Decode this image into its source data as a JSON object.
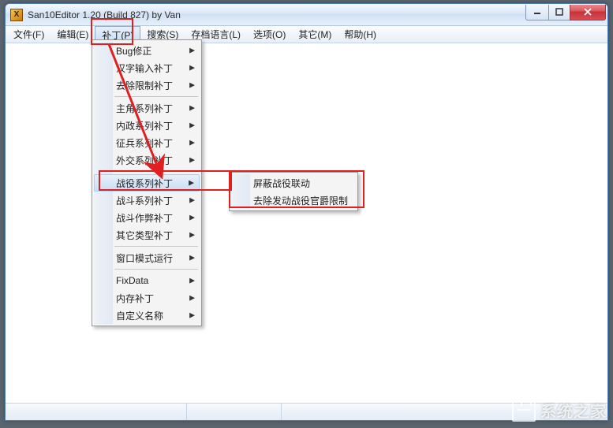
{
  "window": {
    "title": "San10Editor 1.20 (Build 827) by Van"
  },
  "menubar": {
    "items": [
      {
        "label": "文件(F)"
      },
      {
        "label": "编辑(E)"
      },
      {
        "label": "补丁(P)",
        "active": true
      },
      {
        "label": "搜索(S)"
      },
      {
        "label": "存档语言(L)"
      },
      {
        "label": "选项(O)"
      },
      {
        "label": "其它(M)"
      },
      {
        "label": "帮助(H)"
      }
    ]
  },
  "patch_menu": {
    "groups": [
      [
        {
          "label": "Bug修正",
          "sub": true
        },
        {
          "label": "汉字输入补丁",
          "sub": true
        },
        {
          "label": "去除限制补丁",
          "sub": true
        }
      ],
      [
        {
          "label": "主角系列补丁",
          "sub": true
        },
        {
          "label": "内政系列补丁",
          "sub": true
        },
        {
          "label": "征兵系列补丁",
          "sub": true
        },
        {
          "label": "外交系列补丁",
          "sub": true
        }
      ],
      [
        {
          "label": "战役系列补丁",
          "sub": true,
          "hover": true
        },
        {
          "label": "战斗系列补丁",
          "sub": true
        },
        {
          "label": "战斗作弊补丁",
          "sub": true
        },
        {
          "label": "其它类型补丁",
          "sub": true
        }
      ],
      [
        {
          "label": "窗口模式运行",
          "sub": true
        }
      ],
      [
        {
          "label": "FixData",
          "sub": true
        },
        {
          "label": "内存补丁",
          "sub": true
        },
        {
          "label": "自定义名称",
          "sub": true
        }
      ]
    ]
  },
  "battle_submenu": {
    "items": [
      {
        "label": "屏蔽战役联动"
      },
      {
        "label": "去除发动战役官爵限制"
      }
    ]
  },
  "watermark": {
    "text": "系统之家"
  }
}
